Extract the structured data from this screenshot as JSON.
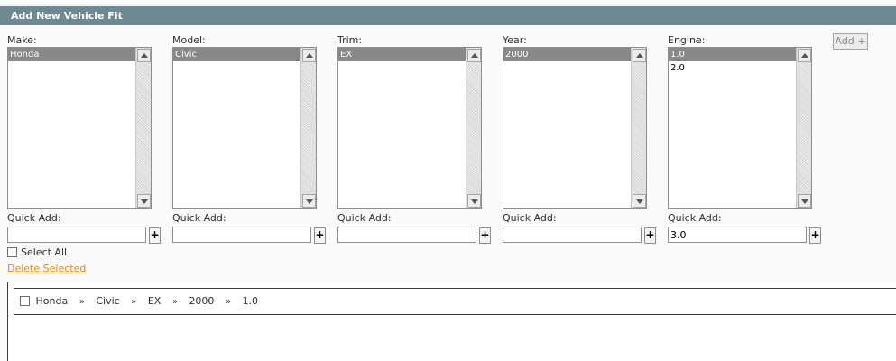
{
  "panel": {
    "title": "Add New Vehicle Fit"
  },
  "add_button": {
    "label": "Add +"
  },
  "columns": [
    {
      "label": "Make:",
      "options": [
        "Honda"
      ],
      "selected_index": 0,
      "quick_add_label": "Quick Add:",
      "quick_add_value": ""
    },
    {
      "label": "Model:",
      "options": [
        "Civic"
      ],
      "selected_index": 0,
      "quick_add_label": "Quick Add:",
      "quick_add_value": ""
    },
    {
      "label": "Trim:",
      "options": [
        "EX"
      ],
      "selected_index": 0,
      "quick_add_label": "Quick Add:",
      "quick_add_value": ""
    },
    {
      "label": "Year:",
      "options": [
        "2000"
      ],
      "selected_index": 0,
      "quick_add_label": "Quick Add:",
      "quick_add_value": ""
    },
    {
      "label": "Engine:",
      "options": [
        "1.0",
        "2.0"
      ],
      "selected_index": 0,
      "quick_add_label": "Quick Add:",
      "quick_add_value": "3.0"
    }
  ],
  "quick_add_button_label": "+",
  "select_all": {
    "label": "Select All"
  },
  "delete_selected": {
    "label": "Delete Selected"
  },
  "fits": [
    {
      "path": [
        "Honda",
        "Civic",
        "EX",
        "2000",
        "1.0"
      ]
    }
  ],
  "path_separator": "»",
  "colors": {
    "header_bg": "#6f8992",
    "link": "#e08a1e",
    "selected_option_bg": "#888888"
  }
}
